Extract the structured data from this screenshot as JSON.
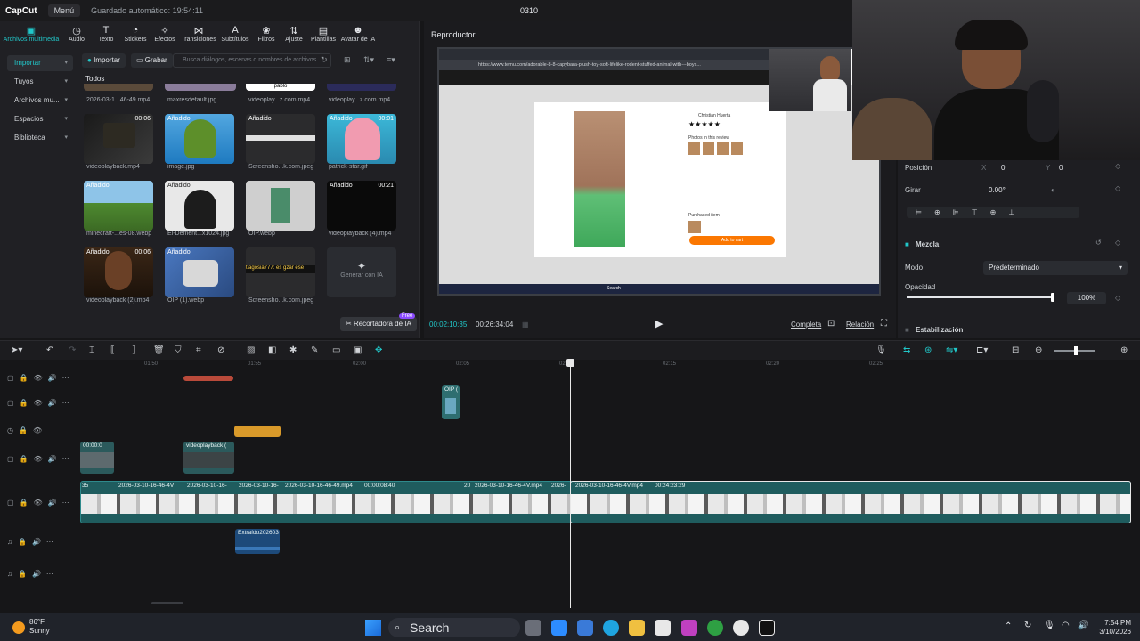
{
  "titlebar": {
    "app": "CapCut",
    "menu": "Menú",
    "autosave": "Guardado automático: 19:54:11",
    "project": "0310"
  },
  "tabs": [
    {
      "icon": "media-icon",
      "label": "Archivos multimedia"
    },
    {
      "icon": "audio-icon",
      "label": "Audio"
    },
    {
      "icon": "text-icon",
      "label": "Texto"
    },
    {
      "icon": "stickers-icon",
      "label": "Stickers"
    },
    {
      "icon": "effects-icon",
      "label": "Efectos"
    },
    {
      "icon": "transitions-icon",
      "label": "Transiciones"
    },
    {
      "icon": "subtitles-icon",
      "label": "Subtítulos"
    },
    {
      "icon": "filters-icon",
      "label": "Filtros"
    },
    {
      "icon": "adjust-icon",
      "label": "Ajuste"
    },
    {
      "icon": "templates-icon",
      "label": "Plantillas"
    },
    {
      "icon": "ai-avatar-icon",
      "label": "Avatar de IA"
    }
  ],
  "leftnav": [
    "Importar",
    "Tuyos",
    "Archivos mu...",
    "Espacios",
    "Biblioteca"
  ],
  "media": {
    "import_btn": "Importar",
    "record_btn": "Grabar",
    "search_placeholder": "Busca diálogos, escenas o nombres de archivos",
    "section": "Todos",
    "top_row": [
      "2026-03-1...46-49.mp4",
      "maxresdefault.jpg",
      "videoplay...z.com.mp4",
      "videoplay...z.com.mp4"
    ],
    "items": [
      {
        "name": "videoplayback.mp4",
        "badge": "",
        "dur": "00:06"
      },
      {
        "name": "image.jpg",
        "badge": "Añadido",
        "dur": ""
      },
      {
        "name": "Screensho...k.com.jpeg",
        "badge": "Añadido",
        "dur": ""
      },
      {
        "name": "patrick-star.gif",
        "badge": "Añadido",
        "dur": "00:01"
      },
      {
        "name": "minecraft-...es-08.webp",
        "badge": "Añadido",
        "dur": ""
      },
      {
        "name": "El-Dement...x1024.jpg",
        "badge": "Añadido",
        "dur": ""
      },
      {
        "name": "OIP.webp",
        "badge": "",
        "dur": ""
      },
      {
        "name": "videoplayback (4).mp4",
        "badge": "Añadido",
        "dur": "00:21"
      },
      {
        "name": "videoplayback (2).mp4",
        "badge": "Añadido",
        "dur": "00:06"
      },
      {
        "name": "OIP (1).webp",
        "badge": "Añadido",
        "dur": ""
      },
      {
        "name": "Screensho...k.com.jpeg",
        "badge": "",
        "dur": ""
      }
    ],
    "thumb_text_1": "pablo",
    "thumb_text_2": "tiagosia777: es gzar ese",
    "generate": "Generar con IA",
    "cutout_btn": "Recortadora de IA",
    "cutout_badge": "Free"
  },
  "player": {
    "title": "Reproductor",
    "current_time": "00:02:10:35",
    "total_time": "00:26:34:04",
    "full_btn": "Completa",
    "ratio_btn": "Relación",
    "browser_url": "https://www.temu.com/adorable-8-8-capybara-plush-toy-soft-lifelike-rodent-stuffed-animal-with---boys...",
    "review_name": "Christian Huerta",
    "review_stars": "★★★★★",
    "review_photos": "Photos in this review",
    "purchased": "Purchased item",
    "add_to_cart": "Add to cart",
    "win_search": "Search"
  },
  "inspector": {
    "position_label": "Posición",
    "x_label": "X",
    "x_value": "0",
    "y_label": "Y",
    "y_value": "0",
    "rotate_label": "Girar",
    "rotate_value": "0.00°",
    "blend_label": "Mezcla",
    "mode_label": "Modo",
    "mode_value": "Predeterminado",
    "opacity_label": "Opacidad",
    "opacity_value": "100%",
    "opacity_level": 1.0,
    "stabilize_label": "Estabilización"
  },
  "ruler": [
    "01:50",
    "01:55",
    "02:00",
    "02:05",
    "02:10",
    "02:15",
    "02:20",
    "02:25"
  ],
  "timeline": {
    "clip_oip": "OIP (",
    "clip_v1": "00:00:0",
    "clip_v2": "videoplayback (",
    "main_labels": [
      "35",
      "2026-03-10-16-46-4V",
      "2026-03-10-16-",
      "2026-03-10-16-",
      "2026-03-10-16-46-49.mp4",
      "00:00:08:40",
      "20",
      "2026-03-10-16-46-4V.mp4",
      "2026-",
      "2026-03-10-16-46-4V.mp4",
      "00:24:23:29"
    ],
    "audio_clip": "Extraído202603"
  },
  "taskbar": {
    "temp": "86°F",
    "condition": "Sunny",
    "search": "Search",
    "time": "7:54 PM",
    "date": "3/10/2026"
  }
}
